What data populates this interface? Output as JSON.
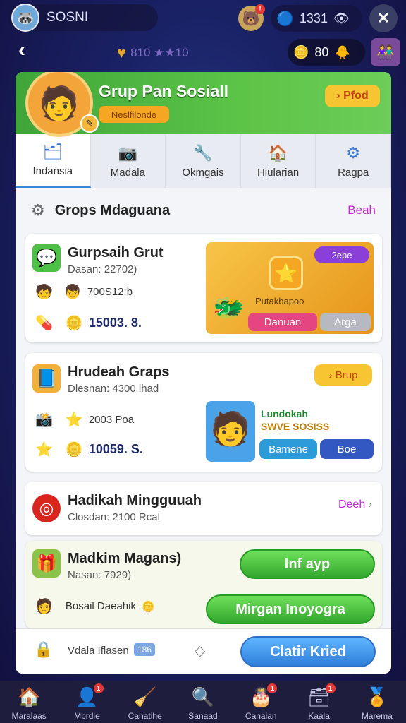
{
  "topbar": {
    "profile_name": "SOSNI",
    "coin_value": "1331"
  },
  "subbar": {
    "middle_text": "810 ★★10",
    "coins": "80"
  },
  "header": {
    "title": "Grup Pan Sosiall",
    "subtitle": "Neslfilonde",
    "mod_button": "› Pfod"
  },
  "tabs": [
    {
      "label": "Indansia",
      "icon": "🗂"
    },
    {
      "label": "Madala",
      "icon": "📷"
    },
    {
      "label": "Okmgais",
      "icon": "🔧"
    },
    {
      "label": "Hiularian",
      "icon": "🏠"
    },
    {
      "label": "Ragpa",
      "icon": "⚙"
    }
  ],
  "section": {
    "title": "Grops Mdaguana",
    "more": "Beah"
  },
  "card1": {
    "title": "Gurpsaih Grut",
    "subtitle": "Dasan: 22702)",
    "members": "700S12:b",
    "coins": "15003. 8.",
    "promo_title": "Putakbapoo",
    "promo_tag": "2epe",
    "promo_btn1": "Danuan",
    "promo_btn2": "Arga"
  },
  "card2": {
    "title": "Hrudeah Graps",
    "subtitle": "Dlesnan: 4300 lhad",
    "badge": "› Brup",
    "stat1": "2003 Poa",
    "coins": "10059. S.",
    "promo_line1": "Lundokah",
    "promo_line2": "SWVE SOSISS",
    "promo_btn1": "Bamene",
    "promo_btn2": "Boe"
  },
  "card3": {
    "title": "Hadikah Mingguuah",
    "subtitle": "Closdan: 2100 Rcal",
    "more": "Deeh"
  },
  "card4": {
    "title": "Madkim Magans)",
    "subtitle": "Nasan: 7929)",
    "stat": "Bosail Daeahik",
    "btn1": "Inf ayp",
    "btn2": "Mirgan Inoyogra"
  },
  "footer": {
    "label": "Vdala Iflasen",
    "badge": "186",
    "cta": "Clatir Kried"
  },
  "bottom_nav": [
    {
      "label": "Maralaas",
      "icon": "🏠",
      "badge": ""
    },
    {
      "label": "Mbrdie",
      "icon": "👤",
      "badge": "1"
    },
    {
      "label": "Canatihe",
      "icon": "🧹",
      "badge": ""
    },
    {
      "label": "Sanaad",
      "icon": "🔍",
      "badge": ""
    },
    {
      "label": "Canaian",
      "icon": "🎂",
      "badge": "1"
    },
    {
      "label": "Kaala",
      "icon": "🗃",
      "badge": "1"
    },
    {
      "label": "Marema",
      "icon": "🏅",
      "badge": ""
    }
  ]
}
